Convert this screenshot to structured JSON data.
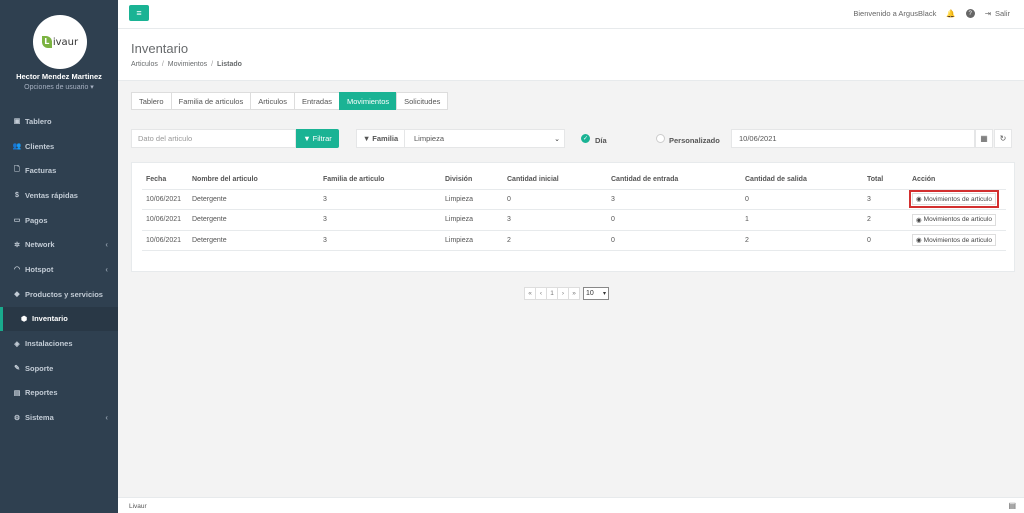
{
  "sidebar": {
    "logo_text": "ivaur",
    "logo_letter": "L",
    "user_name": "Hector Mendez Martinez",
    "user_options": "Opciones de usuario ▾",
    "items": [
      {
        "label": "Tablero",
        "icon": "dashboard-icon",
        "glyph": "▣"
      },
      {
        "label": "Clientes",
        "icon": "users-icon",
        "glyph": "👥"
      },
      {
        "label": "Facturas",
        "icon": "file-icon",
        "glyph": "🗋"
      },
      {
        "label": "Ventas rápidas",
        "icon": "dollar-icon",
        "glyph": "$"
      },
      {
        "label": "Pagos",
        "icon": "money-icon",
        "glyph": "▭"
      },
      {
        "label": "Network",
        "icon": "network-icon",
        "glyph": "✲"
      },
      {
        "label": "Hotspot",
        "icon": "wifi-icon",
        "glyph": "◠"
      },
      {
        "label": "Productos y servicios",
        "icon": "tag-icon",
        "glyph": "◆"
      },
      {
        "label": "Inventario",
        "icon": "cubes-icon",
        "glyph": "⬢"
      },
      {
        "label": "Instalaciones",
        "icon": "tools-icon",
        "glyph": "◈"
      },
      {
        "label": "Soporte",
        "icon": "wrench-icon",
        "glyph": "✎"
      },
      {
        "label": "Reportes",
        "icon": "book-icon",
        "glyph": "▤"
      },
      {
        "label": "Sistema",
        "icon": "cogs-icon",
        "glyph": "⚙"
      }
    ],
    "caret": "‹"
  },
  "topbar": {
    "welcome": "Bienvenido a ArgusBlack",
    "logout": "Salir"
  },
  "heading": {
    "title": "Inventario",
    "breadcrumb": [
      "Articulos",
      "Movimientos",
      "Listado"
    ]
  },
  "tabs": [
    "Tablero",
    "Familia de articulos",
    "Articulos",
    "Entradas",
    "Movimientos",
    "Solicitudes"
  ],
  "filters": {
    "search_placeholder": "Dato del articulo",
    "filter_button": "Filtrar",
    "familia_label": "Familia",
    "familia_value": "Limpieza",
    "radio_dia": "Día",
    "radio_personalizado": "Personalizado",
    "date_value": "10/06/2021"
  },
  "table": {
    "headers": [
      "Fecha",
      "Nombre del articulo",
      "Familia de articulo",
      "División",
      "Cantidad inicial",
      "Cantidad de entrada",
      "Cantidad de salida",
      "Total",
      "Acción"
    ],
    "rows": [
      {
        "fecha": "10/06/2021",
        "nombre": "Detergente",
        "familia": "3",
        "division": "Limpieza",
        "inicial": "0",
        "entrada": "3",
        "salida": "0",
        "total": "3",
        "accion": "Movimientos de articulo"
      },
      {
        "fecha": "10/06/2021",
        "nombre": "Detergente",
        "familia": "3",
        "division": "Limpieza",
        "inicial": "3",
        "entrada": "0",
        "salida": "1",
        "total": "2",
        "accion": "Movimientos de articulo"
      },
      {
        "fecha": "10/06/2021",
        "nombre": "Detergente",
        "familia": "3",
        "division": "Limpieza",
        "inicial": "2",
        "entrada": "0",
        "salida": "2",
        "total": "0",
        "accion": "Movimientos de articulo"
      }
    ]
  },
  "pagination": {
    "first": "«",
    "prev": "‹",
    "page": "1",
    "next": "›",
    "last": "»",
    "page_size": "10"
  },
  "footer": {
    "text": "Livaur"
  },
  "colors": {
    "accent": "#1ab394",
    "sidebar": "#2f4050",
    "highlight": "#d32f2f"
  }
}
